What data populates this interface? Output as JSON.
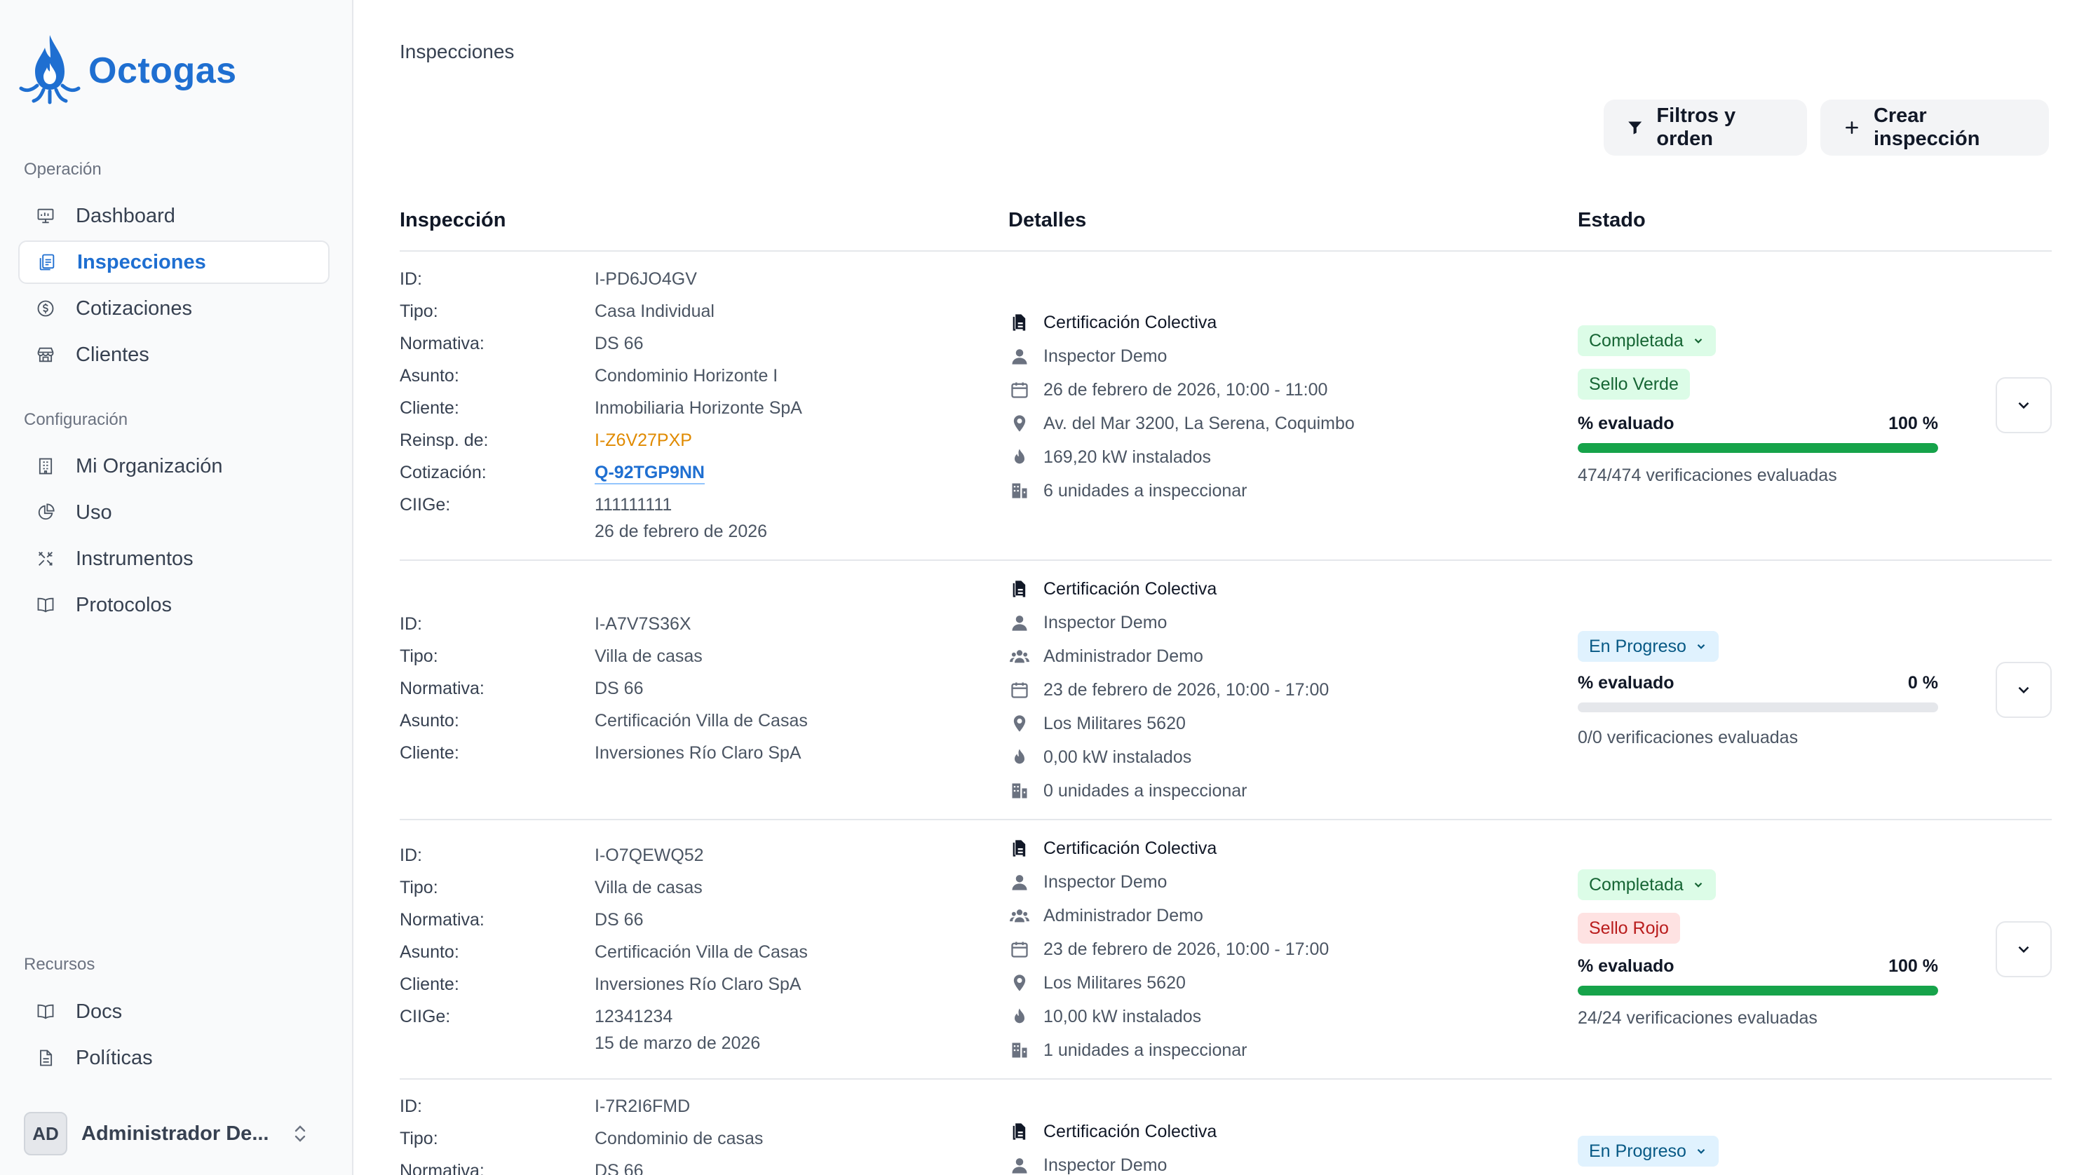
{
  "app": {
    "name": "Octogas",
    "brand_color": "#1f6fd1"
  },
  "sidebar": {
    "sections": [
      {
        "label": "Operación",
        "items": [
          {
            "label": "Dashboard",
            "icon": "dashboard-icon"
          },
          {
            "label": "Inspecciones",
            "icon": "clipboard-icon",
            "active": true
          },
          {
            "label": "Cotizaciones",
            "icon": "dollar-icon"
          },
          {
            "label": "Clientes",
            "icon": "store-icon"
          }
        ]
      },
      {
        "label": "Configuración",
        "items": [
          {
            "label": "Mi Organización",
            "icon": "building-icon"
          },
          {
            "label": "Uso",
            "icon": "pie-chart-icon"
          },
          {
            "label": "Instrumentos",
            "icon": "tools-icon"
          },
          {
            "label": "Protocolos",
            "icon": "book-icon"
          }
        ]
      },
      {
        "label": "Recursos",
        "items": [
          {
            "label": "Docs",
            "icon": "book-icon"
          },
          {
            "label": "Políticas",
            "icon": "document-icon"
          }
        ]
      }
    ],
    "user": {
      "initials": "AD",
      "name": "Administrador De..."
    }
  },
  "header": {
    "breadcrumb": "Inspecciones",
    "filter_button": "Filtros y orden",
    "create_button": "Crear inspección"
  },
  "table": {
    "columns": [
      "Inspección",
      "Detalles",
      "Estado"
    ],
    "rows": [
      {
        "fields": [
          {
            "k": "ID:",
            "v": "I-PD6JO4GV"
          },
          {
            "k": "Tipo:",
            "v": "Casa Individual"
          },
          {
            "k": "Normativa:",
            "v": "DS 66"
          },
          {
            "k": "Asunto:",
            "v": "Condominio Horizonte I"
          },
          {
            "k": "Cliente:",
            "v": "Inmobiliaria Horizonte SpA"
          },
          {
            "k": "Reinsp. de:",
            "v": "I-Z6V27PXP",
            "style": "orange"
          },
          {
            "k": "Cotización:",
            "v": "Q-92TGP9NN",
            "style": "link"
          },
          {
            "k": "CIIGe:",
            "v": "111111111"
          },
          {
            "k": "",
            "v": "26 de febrero de 2026"
          }
        ],
        "details": [
          {
            "icon": "certificate-icon",
            "text": "Certificación Colectiva"
          },
          {
            "icon": "user-icon",
            "text": "Inspector Demo"
          },
          {
            "icon": "calendar-icon",
            "text": "26 de febrero de 2026, 10:00 - 11:00"
          },
          {
            "icon": "location-icon",
            "text": "Av. del Mar 3200, La Serena, Coquimbo"
          },
          {
            "icon": "flame-icon",
            "text": "169,20 kW instalados"
          },
          {
            "icon": "units-icon",
            "text": "6 unidades a inspeccionar"
          }
        ],
        "status": "Completada",
        "status_color": "green",
        "seal": "Sello Verde",
        "seal_color": "green",
        "progress_label": "% evaluado",
        "progress_value": "100 %",
        "progress": 1.0,
        "verifications": "474/474 verificaciones evaluadas"
      },
      {
        "fields": [
          {
            "k": "ID:",
            "v": "I-A7V7S36X"
          },
          {
            "k": "Tipo:",
            "v": "Villa de casas"
          },
          {
            "k": "Normativa:",
            "v": "DS 66"
          },
          {
            "k": "Asunto:",
            "v": "Certificación Villa de Casas"
          },
          {
            "k": "Cliente:",
            "v": "Inversiones Río Claro SpA"
          }
        ],
        "details": [
          {
            "icon": "certificate-icon",
            "text": "Certificación Colectiva"
          },
          {
            "icon": "user-icon",
            "text": "Inspector Demo"
          },
          {
            "icon": "users-icon",
            "text": "Administrador Demo"
          },
          {
            "icon": "calendar-icon",
            "text": "23 de febrero de 2026, 10:00 - 17:00"
          },
          {
            "icon": "location-icon",
            "text": "Los Militares 5620"
          },
          {
            "icon": "flame-icon",
            "text": "0,00 kW instalados"
          },
          {
            "icon": "units-icon",
            "text": "0 unidades a inspeccionar"
          }
        ],
        "status": "En Progreso",
        "status_color": "blue",
        "seal": "",
        "seal_color": "",
        "progress_label": "% evaluado",
        "progress_value": "0 %",
        "progress": 0.0,
        "verifications": "0/0 verificaciones evaluadas"
      },
      {
        "fields": [
          {
            "k": "ID:",
            "v": "I-O7QEWQ52"
          },
          {
            "k": "Tipo:",
            "v": "Villa de casas"
          },
          {
            "k": "Normativa:",
            "v": "DS 66"
          },
          {
            "k": "Asunto:",
            "v": "Certificación Villa de Casas"
          },
          {
            "k": "Cliente:",
            "v": "Inversiones Río Claro SpA"
          },
          {
            "k": "CIIGe:",
            "v": "12341234"
          },
          {
            "k": "",
            "v": "15 de marzo de 2026"
          }
        ],
        "details": [
          {
            "icon": "certificate-icon",
            "text": "Certificación Colectiva"
          },
          {
            "icon": "user-icon",
            "text": "Inspector Demo"
          },
          {
            "icon": "users-icon",
            "text": "Administrador Demo"
          },
          {
            "icon": "calendar-icon",
            "text": "23 de febrero de 2026, 10:00 - 17:00"
          },
          {
            "icon": "location-icon",
            "text": "Los Militares 5620"
          },
          {
            "icon": "flame-icon",
            "text": "10,00 kW instalados"
          },
          {
            "icon": "units-icon",
            "text": "1 unidades a inspeccionar"
          }
        ],
        "status": "Completada",
        "status_color": "green",
        "seal": "Sello Rojo",
        "seal_color": "red",
        "progress_label": "% evaluado",
        "progress_value": "100 %",
        "progress": 1.0,
        "verifications": "24/24 verificaciones evaluadas"
      },
      {
        "fields": [
          {
            "k": "ID:",
            "v": "I-7R2I6FMD"
          },
          {
            "k": "Tipo:",
            "v": "Condominio de casas"
          },
          {
            "k": "Normativa:",
            "v": "DS 66"
          }
        ],
        "details": [
          {
            "icon": "certificate-icon",
            "text": "Certificación Colectiva"
          },
          {
            "icon": "user-icon",
            "text": "Inspector Demo"
          }
        ],
        "status": "En Progreso",
        "status_color": "blue"
      }
    ]
  }
}
